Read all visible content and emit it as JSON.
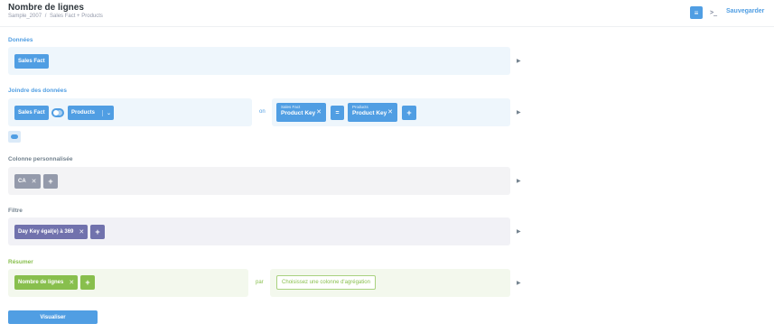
{
  "header": {
    "title": "Nombre de lignes",
    "breadcrumb": [
      "Sample_2007",
      "/",
      "Sales Fact + Products"
    ],
    "save_label": "Sauvegarder",
    "notebook_icon": "notebook-icon",
    "sql_icon": "terminal-icon"
  },
  "sections": {
    "data": {
      "label": "Données",
      "table": "Sales Fact"
    },
    "join": {
      "label": "Joindre des données",
      "left_table": "Sales Fact",
      "right_table": "Products",
      "on_label": "on",
      "left_column": {
        "table": "Sales Fact",
        "column": "Product Key"
      },
      "operator": "=",
      "right_column": {
        "table": "Products",
        "column": "Product Key"
      },
      "add": "+"
    },
    "custom_column": {
      "label": "Colonne personnalisée",
      "column": "CA",
      "add": "+"
    },
    "filter": {
      "label": "Filtre",
      "condition": "Day Key égal(e) à 369",
      "add": "+"
    },
    "summarize": {
      "label": "Résumer",
      "metric": "Nombre de lignes",
      "add": "+",
      "by_label": "par",
      "group_placeholder": "Choisissez une colonne d'agrégation"
    }
  },
  "visualize_label": "Visualiser",
  "colors": {
    "blue": "#509ee3",
    "gray": "#949aab",
    "purple": "#7172ad",
    "green": "#88bf4d"
  }
}
